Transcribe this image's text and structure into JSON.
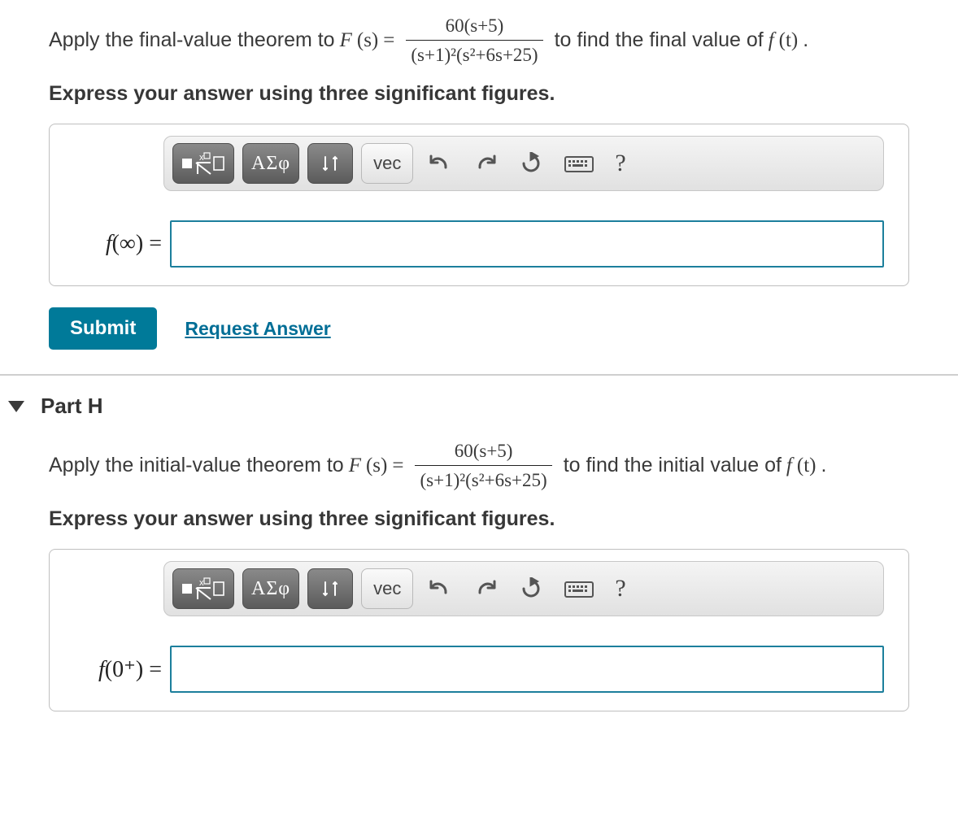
{
  "partG": {
    "prompt_pre": "Apply the final-value theorem to ",
    "F_label": "F",
    "F_arg": "(s)",
    "equals": " = ",
    "numerator": "60(s+5)",
    "denominator": "(s+1)²(s²+6s+25)",
    "prompt_post": " to find the final value of ",
    "f_label": "f",
    "f_arg": "(t)",
    "period": ".",
    "instruction": "Express your answer using three significant figures.",
    "ans_label_pre": "f",
    "ans_label_arg": "(∞) = ",
    "input_value": ""
  },
  "partH": {
    "header": "Part H",
    "prompt_pre": "Apply the initial-value theorem to ",
    "F_label": "F",
    "F_arg": "(s)",
    "equals": " = ",
    "numerator": "60(s+5)",
    "denominator": "(s+1)²(s²+6s+25)",
    "prompt_post": " to find the initial value of ",
    "f_label": "f",
    "f_arg": "(t)",
    "period": ".",
    "instruction": "Express your answer using three significant figures.",
    "ans_label_pre": "f",
    "ans_label_arg": "(0⁺) = ",
    "input_value": ""
  },
  "toolbar": {
    "greek": "ΑΣφ",
    "vec": "vec",
    "help": "?"
  },
  "actions": {
    "submit": "Submit",
    "request": "Request Answer"
  }
}
